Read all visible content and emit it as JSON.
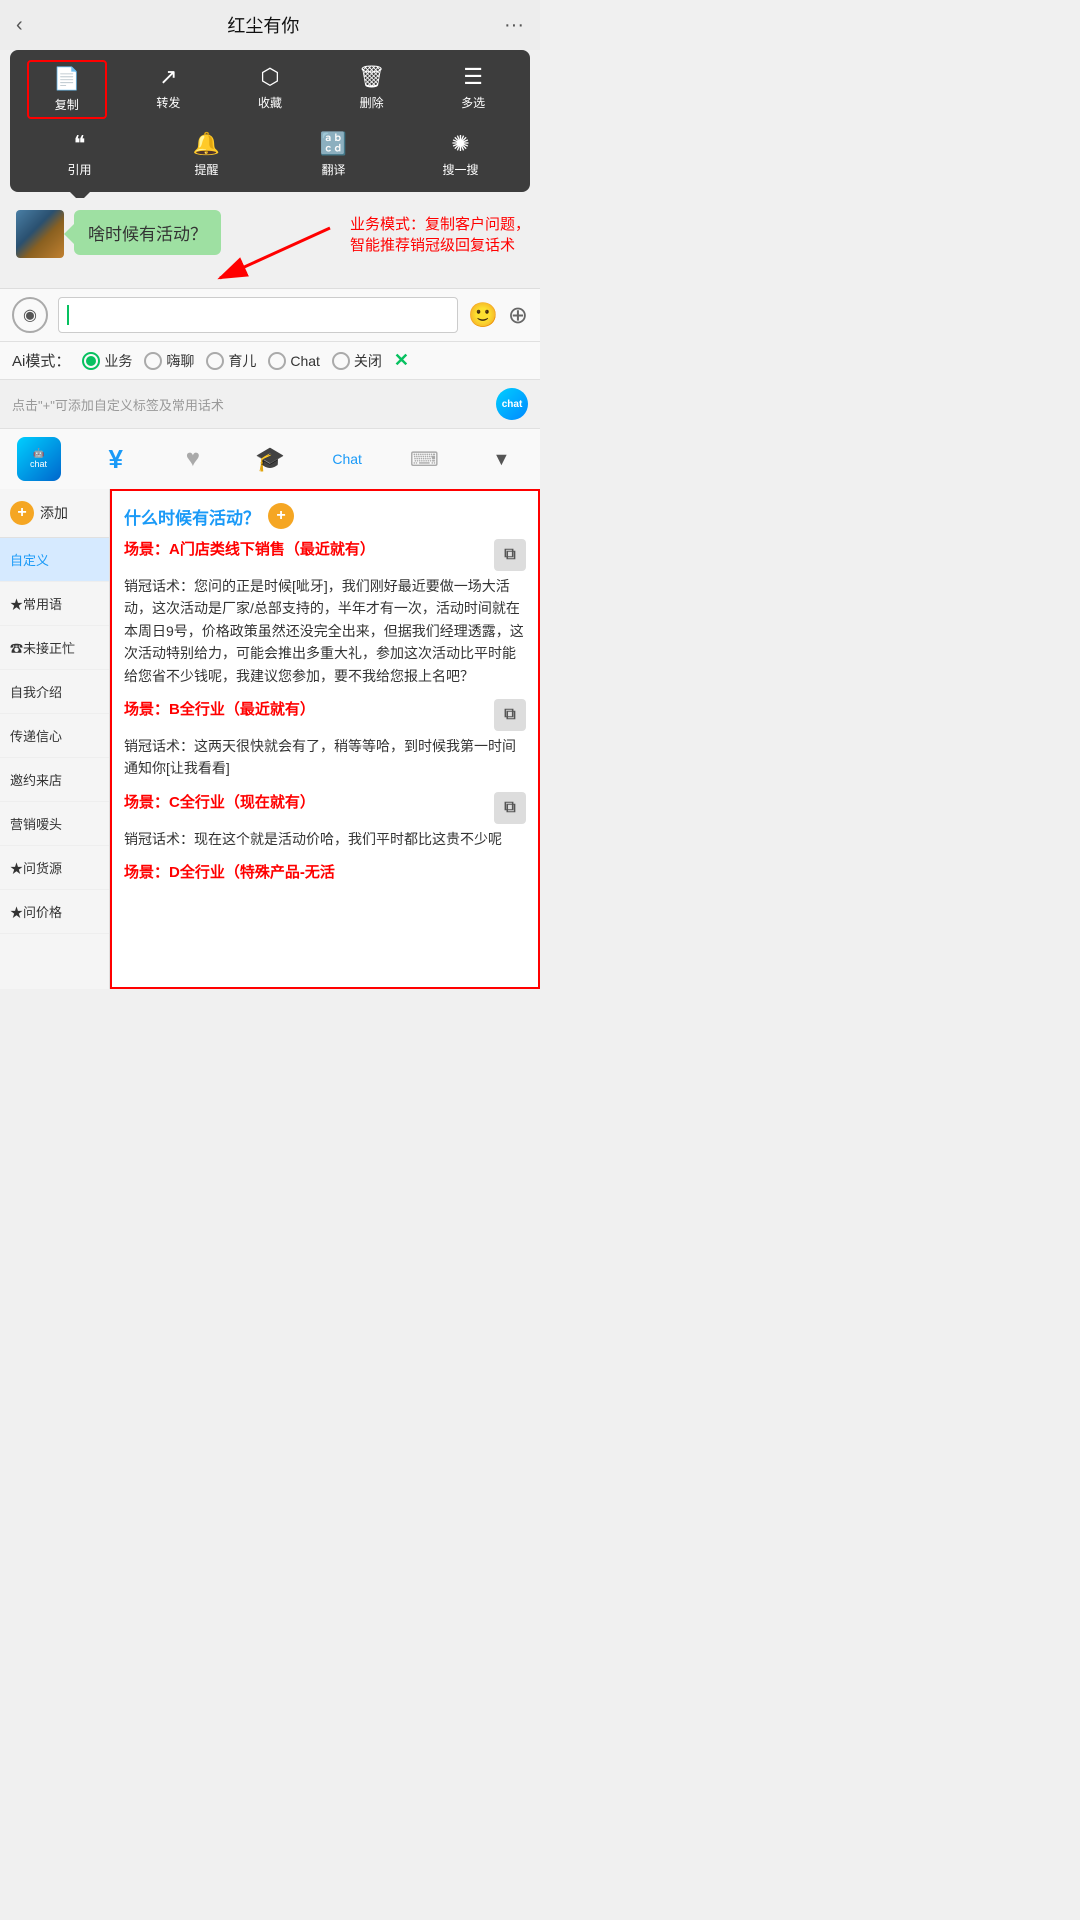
{
  "header": {
    "title": "红尘有你",
    "back_icon": "‹",
    "more_icon": "···"
  },
  "context_menu": {
    "row1": [
      {
        "icon": "📄",
        "label": "复制",
        "highlighted": true
      },
      {
        "icon": "↗",
        "label": "转发"
      },
      {
        "icon": "🎁",
        "label": "收藏"
      },
      {
        "icon": "🗑",
        "label": "删除"
      },
      {
        "icon": "☰",
        "label": "多选"
      }
    ],
    "row2": [
      {
        "icon": "❝",
        "label": "引用"
      },
      {
        "icon": "🔔",
        "label": "提醒"
      },
      {
        "icon": "A→",
        "label": "翻译"
      },
      {
        "icon": "✺",
        "label": "搜一搜"
      }
    ]
  },
  "chat": {
    "message": "啥时候有活动？",
    "annotation": "业务模式：复制客户问题，\n智能推荐销冠级回复话术"
  },
  "ai_modes": {
    "label": "Ai模式：",
    "options": [
      "业务",
      "嗨聊",
      "育儿",
      "Chat",
      "关闭"
    ],
    "active": 0
  },
  "hint_bar": {
    "text": "点击\"+\"可添加自定义标签及常用话术"
  },
  "toolbar": {
    "items": [
      "chat",
      "¥",
      "♥",
      "🎓",
      "Chat",
      "⌨",
      "▼"
    ]
  },
  "sidebar": {
    "add_label": "添加",
    "items": [
      {
        "label": "自定义",
        "active": true
      },
      {
        "label": "★常用语"
      },
      {
        "label": "☎未接正忙"
      },
      {
        "label": "自我介绍"
      },
      {
        "label": "传递信心"
      },
      {
        "label": "邀约来店"
      },
      {
        "label": "营销嗳头"
      },
      {
        "label": "★问货源"
      },
      {
        "label": "★问价格"
      }
    ]
  },
  "right_panel": {
    "question": "什么时候有活动？",
    "scenarios": [
      {
        "title": "场景：A门店类线下销售（最近就有）",
        "content": "销冠话术：您问的正是时候[呲牙]，我们刚好最近要做一场大活动，这次活动是厂家/总部支持的，半年才有一次，活动时间就在本周日9号，价格政策虽然还没完全出来，但据我们经理透露，这次活动特别给力，可能会推出多重大礼，参加这次活动比平时能给您省不少钱呢，我建议您参加，要不我给您报上名吧？"
      },
      {
        "title": "场景：B全行业（最近就有）",
        "content": "销冠话术：这两天很快就会有了，稍等等哈，到时候我第一时间通知你[让我看看]"
      },
      {
        "title": "场景：C全行业（现在就有）",
        "content": "销冠话术：现在这个就是活动价哈，我们平时都比这贵不少呢"
      },
      {
        "title": "场景：D全行业（特殊产品-无活",
        "content": ""
      }
    ]
  }
}
